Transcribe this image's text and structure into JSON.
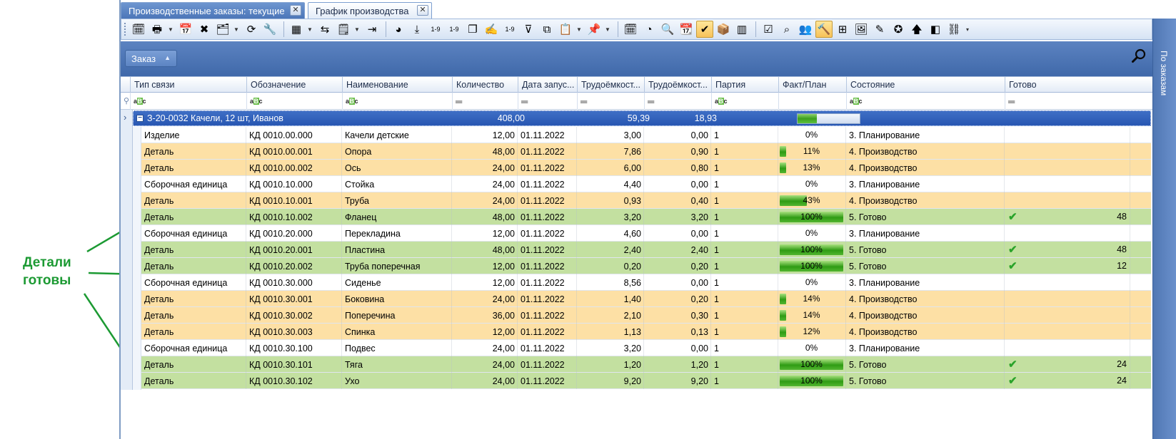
{
  "annotation": {
    "label_line1": "Детали",
    "label_line2": "готовы"
  },
  "tabs": [
    {
      "label": "Производственные заказы: текущие",
      "active": false
    },
    {
      "label": "График производства",
      "active": true
    }
  ],
  "tab_close_glyph": "✕",
  "toolbar": {
    "buttons": [
      {
        "icon": "calendar-settings-icon",
        "glyph": "🗓"
      },
      {
        "icon": "print-icon",
        "glyph": "🖶",
        "dropdown": true
      },
      {
        "icon": "calendar-check-icon",
        "glyph": "📅"
      },
      {
        "icon": "delete-icon",
        "glyph": "✖"
      },
      {
        "icon": "edit-table-icon",
        "glyph": "🗂",
        "dropdown": true
      },
      {
        "icon": "refresh-icon",
        "glyph": "⟳"
      },
      {
        "icon": "wrench-icon",
        "glyph": "🔧"
      },
      {
        "icon": "excel-icon",
        "glyph": "▦",
        "dropdown": true
      },
      {
        "icon": "share-icon",
        "glyph": "⇆"
      },
      {
        "icon": "note-icon",
        "glyph": "🗒",
        "dropdown": true
      },
      {
        "icon": "move-right-icon",
        "glyph": "⇥"
      },
      {
        "icon": "pie-chart-icon",
        "glyph": "◕"
      },
      {
        "icon": "download-icon",
        "glyph": "⤓"
      },
      {
        "icon": "numbering-icon",
        "glyph": "1-9"
      },
      {
        "icon": "numbering-alt-icon",
        "glyph": "1-9"
      },
      {
        "icon": "copy-icon",
        "glyph": "❐"
      },
      {
        "icon": "sign-icon",
        "glyph": "✍"
      },
      {
        "icon": "renumber-icon",
        "glyph": "1-9"
      },
      {
        "icon": "filter-icon",
        "glyph": "⊽"
      },
      {
        "icon": "components-icon",
        "glyph": "⧉"
      },
      {
        "icon": "clipboard-icon",
        "glyph": "📋",
        "dropdown": true
      },
      {
        "icon": "pin-icon",
        "glyph": "📌",
        "dropdown": true
      },
      {
        "icon": "schedule-icon",
        "glyph": "🗓"
      },
      {
        "icon": "gauge-icon",
        "glyph": "◔"
      },
      {
        "icon": "magnifier-icon",
        "glyph": "🔍"
      },
      {
        "icon": "calendar-icon",
        "glyph": "📆"
      },
      {
        "icon": "check-icon",
        "glyph": "✔",
        "active": true
      },
      {
        "icon": "box-icon",
        "glyph": "📦"
      },
      {
        "icon": "barcode-icon",
        "glyph": "▥"
      },
      {
        "icon": "checklist-icon",
        "glyph": "☑"
      },
      {
        "icon": "binoculars-icon",
        "glyph": "⌕"
      },
      {
        "icon": "users-icon",
        "glyph": "👥"
      },
      {
        "icon": "hammer-icon",
        "glyph": "🔨",
        "active": true
      },
      {
        "icon": "hierarchy-icon",
        "glyph": "⊞"
      },
      {
        "icon": "image-icon",
        "glyph": "🖼"
      },
      {
        "icon": "pen-icon",
        "glyph": "✎"
      },
      {
        "icon": "badge-icon",
        "glyph": "✪"
      },
      {
        "icon": "arrow-up-icon",
        "glyph": "🡅"
      },
      {
        "icon": "layers-icon",
        "glyph": "◧"
      },
      {
        "icon": "link-icon",
        "glyph": "⛓"
      }
    ],
    "more_glyph": "▾"
  },
  "side_panel": {
    "label": "По заказам"
  },
  "group_panel": {
    "chip_label": "Заказ",
    "chip_arrow": "▲"
  },
  "columns": [
    {
      "key": "type",
      "label": "Тип связи"
    },
    {
      "key": "code",
      "label": "Обозначение"
    },
    {
      "key": "name",
      "label": "Наименование"
    },
    {
      "key": "qty",
      "label": "Количество"
    },
    {
      "key": "date",
      "label": "Дата запус..."
    },
    {
      "key": "labor1",
      "label": "Трудоёмкост..."
    },
    {
      "key": "labor2",
      "label": "Трудоёмкост..."
    },
    {
      "key": "batch",
      "label": "Партия"
    },
    {
      "key": "progress",
      "label": "Факт/План"
    },
    {
      "key": "status",
      "label": "Состояние"
    },
    {
      "key": "ready",
      "label": "Готово"
    }
  ],
  "filters": [
    "abc",
    "abc",
    "abc",
    "eq",
    "eq",
    "eq",
    "eq",
    "abc",
    "",
    "abc",
    "eq"
  ],
  "group": {
    "title": "З-20-0032 Качели, 12 шт, Иванов",
    "qty": "408,00",
    "labor1": "59,39",
    "labor2": "18,93",
    "progress": 0.3,
    "toggle": "−",
    "expand_glyph": "›"
  },
  "rows": [
    {
      "type": "Изделие",
      "code": "КД 0010.00.000",
      "name": "Качели детские",
      "qty": "12,00",
      "date": "01.11.2022",
      "labor1": "3,00",
      "labor2": "0,00",
      "batch": "1",
      "progress": 0,
      "progress_label": "0%",
      "status": "3. Планирование",
      "state": "plan",
      "ready": ""
    },
    {
      "type": "Деталь",
      "code": "КД 0010.00.001",
      "name": "Опора",
      "qty": "48,00",
      "date": "01.11.2022",
      "labor1": "7,86",
      "labor2": "0,90",
      "batch": "1",
      "progress": 0.11,
      "progress_label": "11%",
      "status": "4. Производство",
      "state": "prod",
      "ready": ""
    },
    {
      "type": "Деталь",
      "code": "КД 0010.00.002",
      "name": "Ось",
      "qty": "24,00",
      "date": "01.11.2022",
      "labor1": "6,00",
      "labor2": "0,80",
      "batch": "1",
      "progress": 0.13,
      "progress_label": "13%",
      "status": "4. Производство",
      "state": "prod",
      "ready": ""
    },
    {
      "type": "Сборочная единица",
      "code": "КД 0010.10.000",
      "name": "Стойка",
      "qty": "24,00",
      "date": "01.11.2022",
      "labor1": "4,40",
      "labor2": "0,00",
      "batch": "1",
      "progress": 0,
      "progress_label": "0%",
      "status": "3. Планирование",
      "state": "plan",
      "ready": ""
    },
    {
      "type": "Деталь",
      "code": "КД 0010.10.001",
      "name": "Труба",
      "qty": "24,00",
      "date": "01.11.2022",
      "labor1": "0,93",
      "labor2": "0,40",
      "batch": "1",
      "progress": 0.43,
      "progress_label": "43%",
      "status": "4. Производство",
      "state": "prod",
      "ready": ""
    },
    {
      "type": "Деталь",
      "code": "КД 0010.10.002",
      "name": "Фланец",
      "qty": "48,00",
      "date": "01.11.2022",
      "labor1": "3,20",
      "labor2": "3,20",
      "batch": "1",
      "progress": 1,
      "progress_label": "100%",
      "status": "5. Готово",
      "state": "done",
      "ready": "48"
    },
    {
      "type": "Сборочная единица",
      "code": "КД 0010.20.000",
      "name": "Перекладина",
      "qty": "12,00",
      "date": "01.11.2022",
      "labor1": "4,60",
      "labor2": "0,00",
      "batch": "1",
      "progress": 0,
      "progress_label": "0%",
      "status": "3. Планирование",
      "state": "plan",
      "ready": ""
    },
    {
      "type": "Деталь",
      "code": "КД 0010.20.001",
      "name": "Пластина",
      "qty": "48,00",
      "date": "01.11.2022",
      "labor1": "2,40",
      "labor2": "2,40",
      "batch": "1",
      "progress": 1,
      "progress_label": "100%",
      "status": "5. Готово",
      "state": "done",
      "ready": "48"
    },
    {
      "type": "Деталь",
      "code": "КД 0010.20.002",
      "name": "Труба поперечная",
      "qty": "12,00",
      "date": "01.11.2022",
      "labor1": "0,20",
      "labor2": "0,20",
      "batch": "1",
      "progress": 1,
      "progress_label": "100%",
      "status": "5. Готово",
      "state": "done",
      "ready": "12"
    },
    {
      "type": "Сборочная единица",
      "code": "КД 0010.30.000",
      "name": "Сиденье",
      "qty": "12,00",
      "date": "01.11.2022",
      "labor1": "8,56",
      "labor2": "0,00",
      "batch": "1",
      "progress": 0,
      "progress_label": "0%",
      "status": "3. Планирование",
      "state": "plan",
      "ready": ""
    },
    {
      "type": "Деталь",
      "code": "КД 0010.30.001",
      "name": "Боковина",
      "qty": "24,00",
      "date": "01.11.2022",
      "labor1": "1,40",
      "labor2": "0,20",
      "batch": "1",
      "progress": 0.14,
      "progress_label": "14%",
      "status": "4. Производство",
      "state": "prod",
      "ready": ""
    },
    {
      "type": "Деталь",
      "code": "КД 0010.30.002",
      "name": "Поперечина",
      "qty": "36,00",
      "date": "01.11.2022",
      "labor1": "2,10",
      "labor2": "0,30",
      "batch": "1",
      "progress": 0.14,
      "progress_label": "14%",
      "status": "4. Производство",
      "state": "prod",
      "ready": ""
    },
    {
      "type": "Деталь",
      "code": "КД 0010.30.003",
      "name": "Спинка",
      "qty": "12,00",
      "date": "01.11.2022",
      "labor1": "1,13",
      "labor2": "0,13",
      "batch": "1",
      "progress": 0.12,
      "progress_label": "12%",
      "status": "4. Производство",
      "state": "prod",
      "ready": ""
    },
    {
      "type": "Сборочная единица",
      "code": "КД 0010.30.100",
      "name": "Подвес",
      "qty": "24,00",
      "date": "01.11.2022",
      "labor1": "3,20",
      "labor2": "0,00",
      "batch": "1",
      "progress": 0,
      "progress_label": "0%",
      "status": "3. Планирование",
      "state": "plan",
      "ready": ""
    },
    {
      "type": "Деталь",
      "code": "КД 0010.30.101",
      "name": "Тяга",
      "qty": "24,00",
      "date": "01.11.2022",
      "labor1": "1,20",
      "labor2": "1,20",
      "batch": "1",
      "progress": 1,
      "progress_label": "100%",
      "status": "5. Готово",
      "state": "done",
      "ready": "24"
    },
    {
      "type": "Деталь",
      "code": "КД 0010.30.102",
      "name": "Ухо",
      "qty": "24,00",
      "date": "01.11.2022",
      "labor1": "9,20",
      "labor2": "9,20",
      "batch": "1",
      "progress": 1,
      "progress_label": "100%",
      "status": "5. Готово",
      "state": "done",
      "ready": "24"
    }
  ],
  "check_glyph": "✔",
  "colors": {
    "plan": "#ffffff",
    "production": "#fde0a5",
    "done": "#c3e0a0",
    "group": "#2f5fba",
    "annotation": "#1c9a33"
  }
}
